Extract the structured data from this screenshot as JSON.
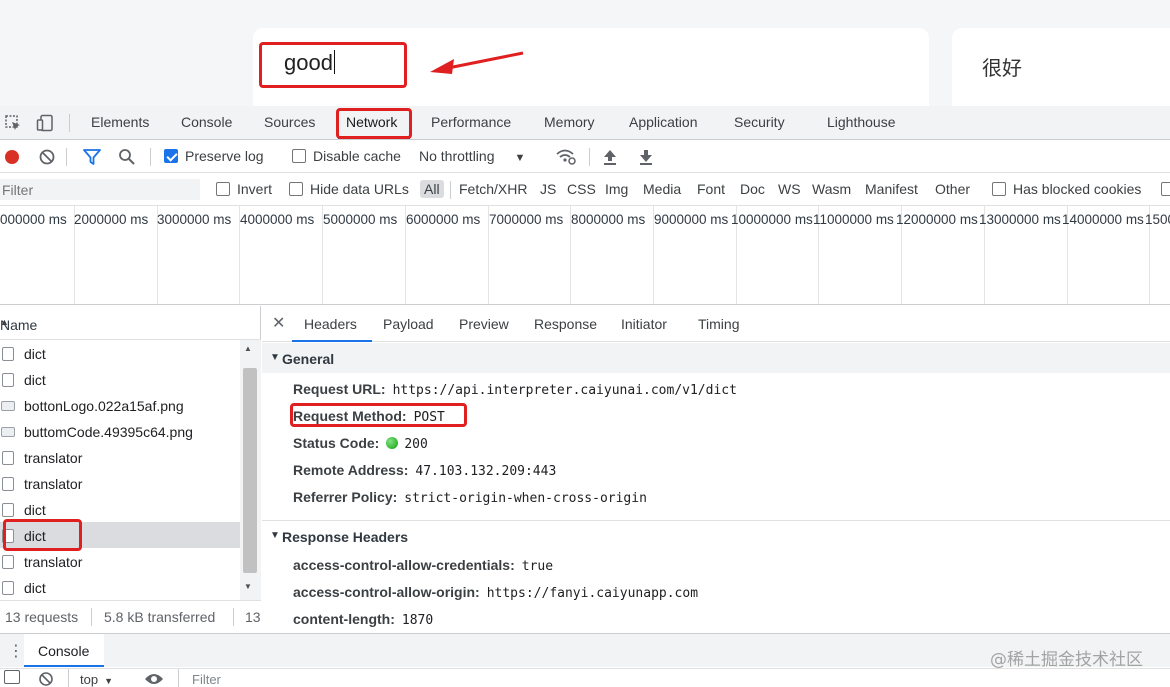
{
  "app": {
    "source_text": "good",
    "translation": "很好"
  },
  "devtools_tabs": [
    "Elements",
    "Console",
    "Sources",
    "Network",
    "Performance",
    "Memory",
    "Application",
    "Security",
    "Lighthouse"
  ],
  "active_tab": "Network",
  "toolbar": {
    "preserve_log": "Preserve log",
    "disable_cache": "Disable cache",
    "throttling": "No throttling"
  },
  "filter": {
    "placeholder": "Filter",
    "invert": "Invert",
    "hide_data_urls": "Hide data URLs",
    "types": [
      "All",
      "Fetch/XHR",
      "JS",
      "CSS",
      "Img",
      "Media",
      "Font",
      "Doc",
      "WS",
      "Wasm",
      "Manifest",
      "Other"
    ],
    "has_blocked_cookies": "Has blocked cookies"
  },
  "overview": {
    "ticks": [
      "000000 ms",
      "2000000 ms",
      "3000000 ms",
      "4000000 ms",
      "5000000 ms",
      "6000000 ms",
      "7000000 ms",
      "8000000 ms",
      "9000000 ms",
      "10000000 ms",
      "11000000 ms",
      "12000000 ms",
      "13000000 ms",
      "14000000 ms",
      "1500"
    ]
  },
  "request_list": {
    "header": "Name",
    "rows": [
      {
        "name": "dict",
        "type": "doc"
      },
      {
        "name": "dict",
        "type": "doc"
      },
      {
        "name": "bottonLogo.022a15af.png",
        "type": "img"
      },
      {
        "name": "buttomCode.49395c64.png",
        "type": "img"
      },
      {
        "name": "translator",
        "type": "doc"
      },
      {
        "name": "translator",
        "type": "doc"
      },
      {
        "name": "dict",
        "type": "doc"
      },
      {
        "name": "dict",
        "type": "doc",
        "selected": true
      },
      {
        "name": "translator",
        "type": "doc"
      },
      {
        "name": "dict",
        "type": "doc"
      }
    ],
    "status": {
      "requests": "13 requests",
      "transferred": "5.8 kB transferred",
      "extra": "13"
    }
  },
  "details": {
    "tabs": [
      "Headers",
      "Payload",
      "Preview",
      "Response",
      "Initiator",
      "Timing"
    ],
    "active_tab": "Headers",
    "general": {
      "title": "General",
      "rows": [
        {
          "key": "Request URL:",
          "value": "https://api.interpreter.caiyunai.com/v1/dict"
        },
        {
          "key": "Request Method:",
          "value": "POST"
        },
        {
          "key": "Status Code:",
          "value": "200"
        },
        {
          "key": "Remote Address:",
          "value": "47.103.132.209:443"
        },
        {
          "key": "Referrer Policy:",
          "value": "strict-origin-when-cross-origin"
        }
      ]
    },
    "response_headers": {
      "title": "Response Headers",
      "rows": [
        {
          "key": "access-control-allow-credentials:",
          "value": "true"
        },
        {
          "key": "access-control-allow-origin:",
          "value": "https://fanyi.caiyunapp.com"
        },
        {
          "key": "content-length:",
          "value": "1870"
        }
      ]
    }
  },
  "drawer": {
    "tab": "Console",
    "context": "top",
    "filter_placeholder": "Filter"
  },
  "watermark": "@稀土掘金技术社区",
  "colors": {
    "accent": "#1a73e8",
    "annotation_red": "#e02020",
    "record_red": "#d93025",
    "status_green": "#0fa00f"
  }
}
